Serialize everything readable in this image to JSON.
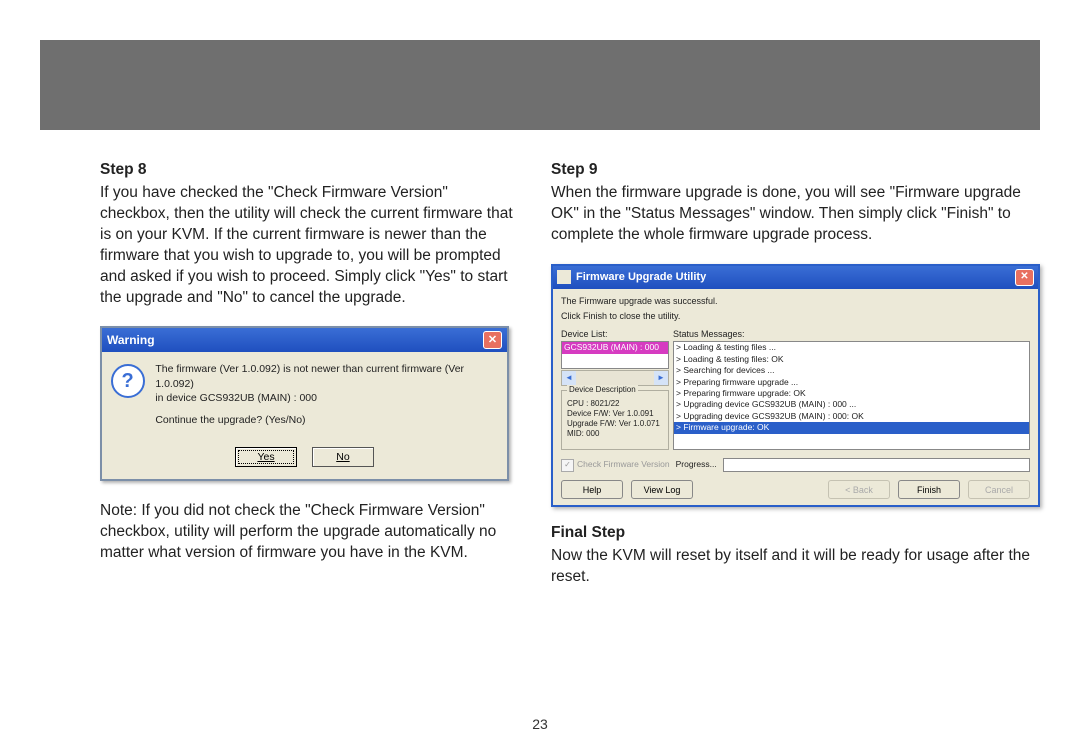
{
  "page_number": "23",
  "left": {
    "step_heading": "Step 8",
    "step_body": "If you have checked the \"Check Firmware Version\" checkbox, then the utility will check the current firmware that is on your KVM. If the current firmware is newer than the firmware that you wish to upgrade to, you will be prompted and asked if you wish to proceed. Simply click \"Yes\" to start the upgrade and \"No\" to cancel the upgrade.",
    "note": "Note: If you did not check the \"Check Firmware Version\" checkbox, utility will perform the upgrade automatically no matter what version of firmware you have in the KVM."
  },
  "right": {
    "step_heading": "Step 9",
    "step_body": "When the firmware upgrade is done, you will see \"Firmware upgrade OK\" in the \"Status Messages\" window. Then simply click \"Finish\" to complete the whole firmware upgrade process.",
    "final_heading": "Final Step",
    "final_body": "Now the KVM will reset by itself and it will be ready for usage after the reset."
  },
  "warning": {
    "title": "Warning",
    "line1": "The firmware (Ver 1.0.092) is not newer than current firmware (Ver 1.0.092)",
    "line2": " in device GCS932UB (MAIN) : 000",
    "line3": "Continue the upgrade? (Yes/No)",
    "yes": "Yes",
    "no": "No"
  },
  "fuu": {
    "title": "Firmware Upgrade Utility",
    "msg1": "The Firmware upgrade was successful.",
    "msg2": "Click Finish to close the utility.",
    "device_list_label": "Device List:",
    "selected_device": "GCS932UB (MAIN) : 000",
    "status_label": "Status Messages:",
    "status_messages": [
      "> Loading & testing files ...",
      "> Loading & testing files: OK",
      "> Searching for devices ...",
      "> Preparing firmware upgrade ...",
      "> Preparing firmware upgrade: OK",
      "> Upgrading device GCS932UB (MAIN) : 000 ...",
      "> Upgrading device GCS932UB (MAIN) : 000: OK",
      "> Firmware upgrade: OK"
    ],
    "desc_legend": "Device Description",
    "desc_lines": [
      "CPU : 8021/22",
      "Device F/W: Ver 1.0.091",
      "Upgrade F/W: Ver 1.0.071",
      "MID: 000"
    ],
    "check_label": "Check Firmware Version",
    "progress_label": "Progress...",
    "btn_help": "Help",
    "btn_viewlog": "View Log",
    "btn_back": "< Back",
    "btn_finish": "Finish",
    "btn_cancel": "Cancel"
  }
}
